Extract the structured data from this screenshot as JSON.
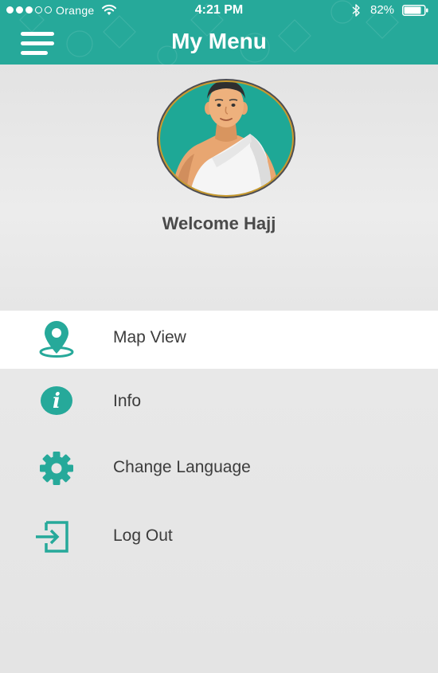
{
  "status_bar": {
    "carrier": "Orange",
    "time": "4:21 PM",
    "battery_percent": "82%",
    "signal_bars_filled": 3,
    "signal_bars_total": 5
  },
  "header": {
    "title": "My Menu",
    "background_color": "#26a99a"
  },
  "profile": {
    "welcome_text": "Welcome Hajj"
  },
  "menu": {
    "items": [
      {
        "label": "Map View",
        "icon": "map-pin-icon",
        "active": true
      },
      {
        "label": "Info",
        "icon": "info-icon",
        "active": false
      },
      {
        "label": "Change Language",
        "icon": "gear-icon",
        "active": false
      },
      {
        "label": "Log Out",
        "icon": "logout-icon",
        "active": false
      }
    ]
  },
  "colors": {
    "accent": "#26a99a",
    "text": "#3c3c3c",
    "background": "#e9e9e9"
  }
}
